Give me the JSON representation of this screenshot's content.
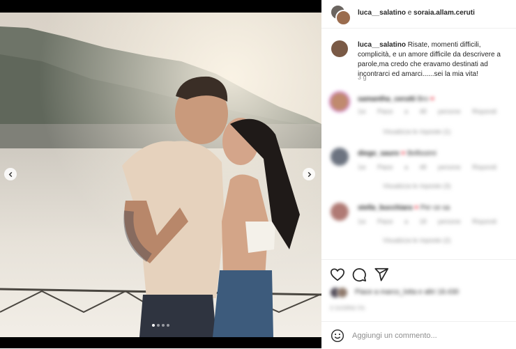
{
  "header": {
    "user1": "luca__salatino",
    "joiner": "e",
    "user2": "soraia.allam.ceruti"
  },
  "caption": {
    "username": "luca__salatino",
    "text": "Risate, momenti difficili, complicità, e un amore difficile da descrivere a parole,ma credo che eravamo destinati ad incontrarci ed amarci......sei la mia vita!",
    "time": "3 g"
  },
  "comments": [
    {
      "username": "samantha_cerutti",
      "text": "Bro",
      "has_heart": true,
      "meta": [
        "1w",
        "Piace a 48 persone",
        "Rispondi"
      ],
      "view_replies": "Visualizza le risposte (1)"
    },
    {
      "username": "diego_sauro",
      "text": "Bellissimi",
      "has_heart": true,
      "meta": [
        "1w",
        "Piace a 48 persone",
        "Rispondi"
      ],
      "view_replies": "Visualizza le risposte (3)"
    },
    {
      "username": "stella_bucchiara",
      "text": "Per ce sa",
      "has_heart": true,
      "meta": [
        "1w",
        "Piace a 18 persone",
        "Rispondi"
      ],
      "view_replies": "Visualizza le risposte (2)"
    }
  ],
  "likes": {
    "text": "Piace a marco_lotta e altri 18.430"
  },
  "post_date": "3 GIORNI FA",
  "add_comment": {
    "placeholder": "Aggiungi un commento..."
  },
  "carousel": {
    "active_index": 0,
    "count": 4
  },
  "icons": {
    "like": "heart-outline-icon",
    "comment": "speech-bubble-icon",
    "share": "paper-plane-icon",
    "emoji": "smiley-icon",
    "prev": "chevron-left-icon",
    "next": "chevron-right-icon"
  },
  "colors": {
    "text": "#262626",
    "secondary": "#8e8e8e",
    "border": "#efefef",
    "heart": "#ed4956"
  }
}
